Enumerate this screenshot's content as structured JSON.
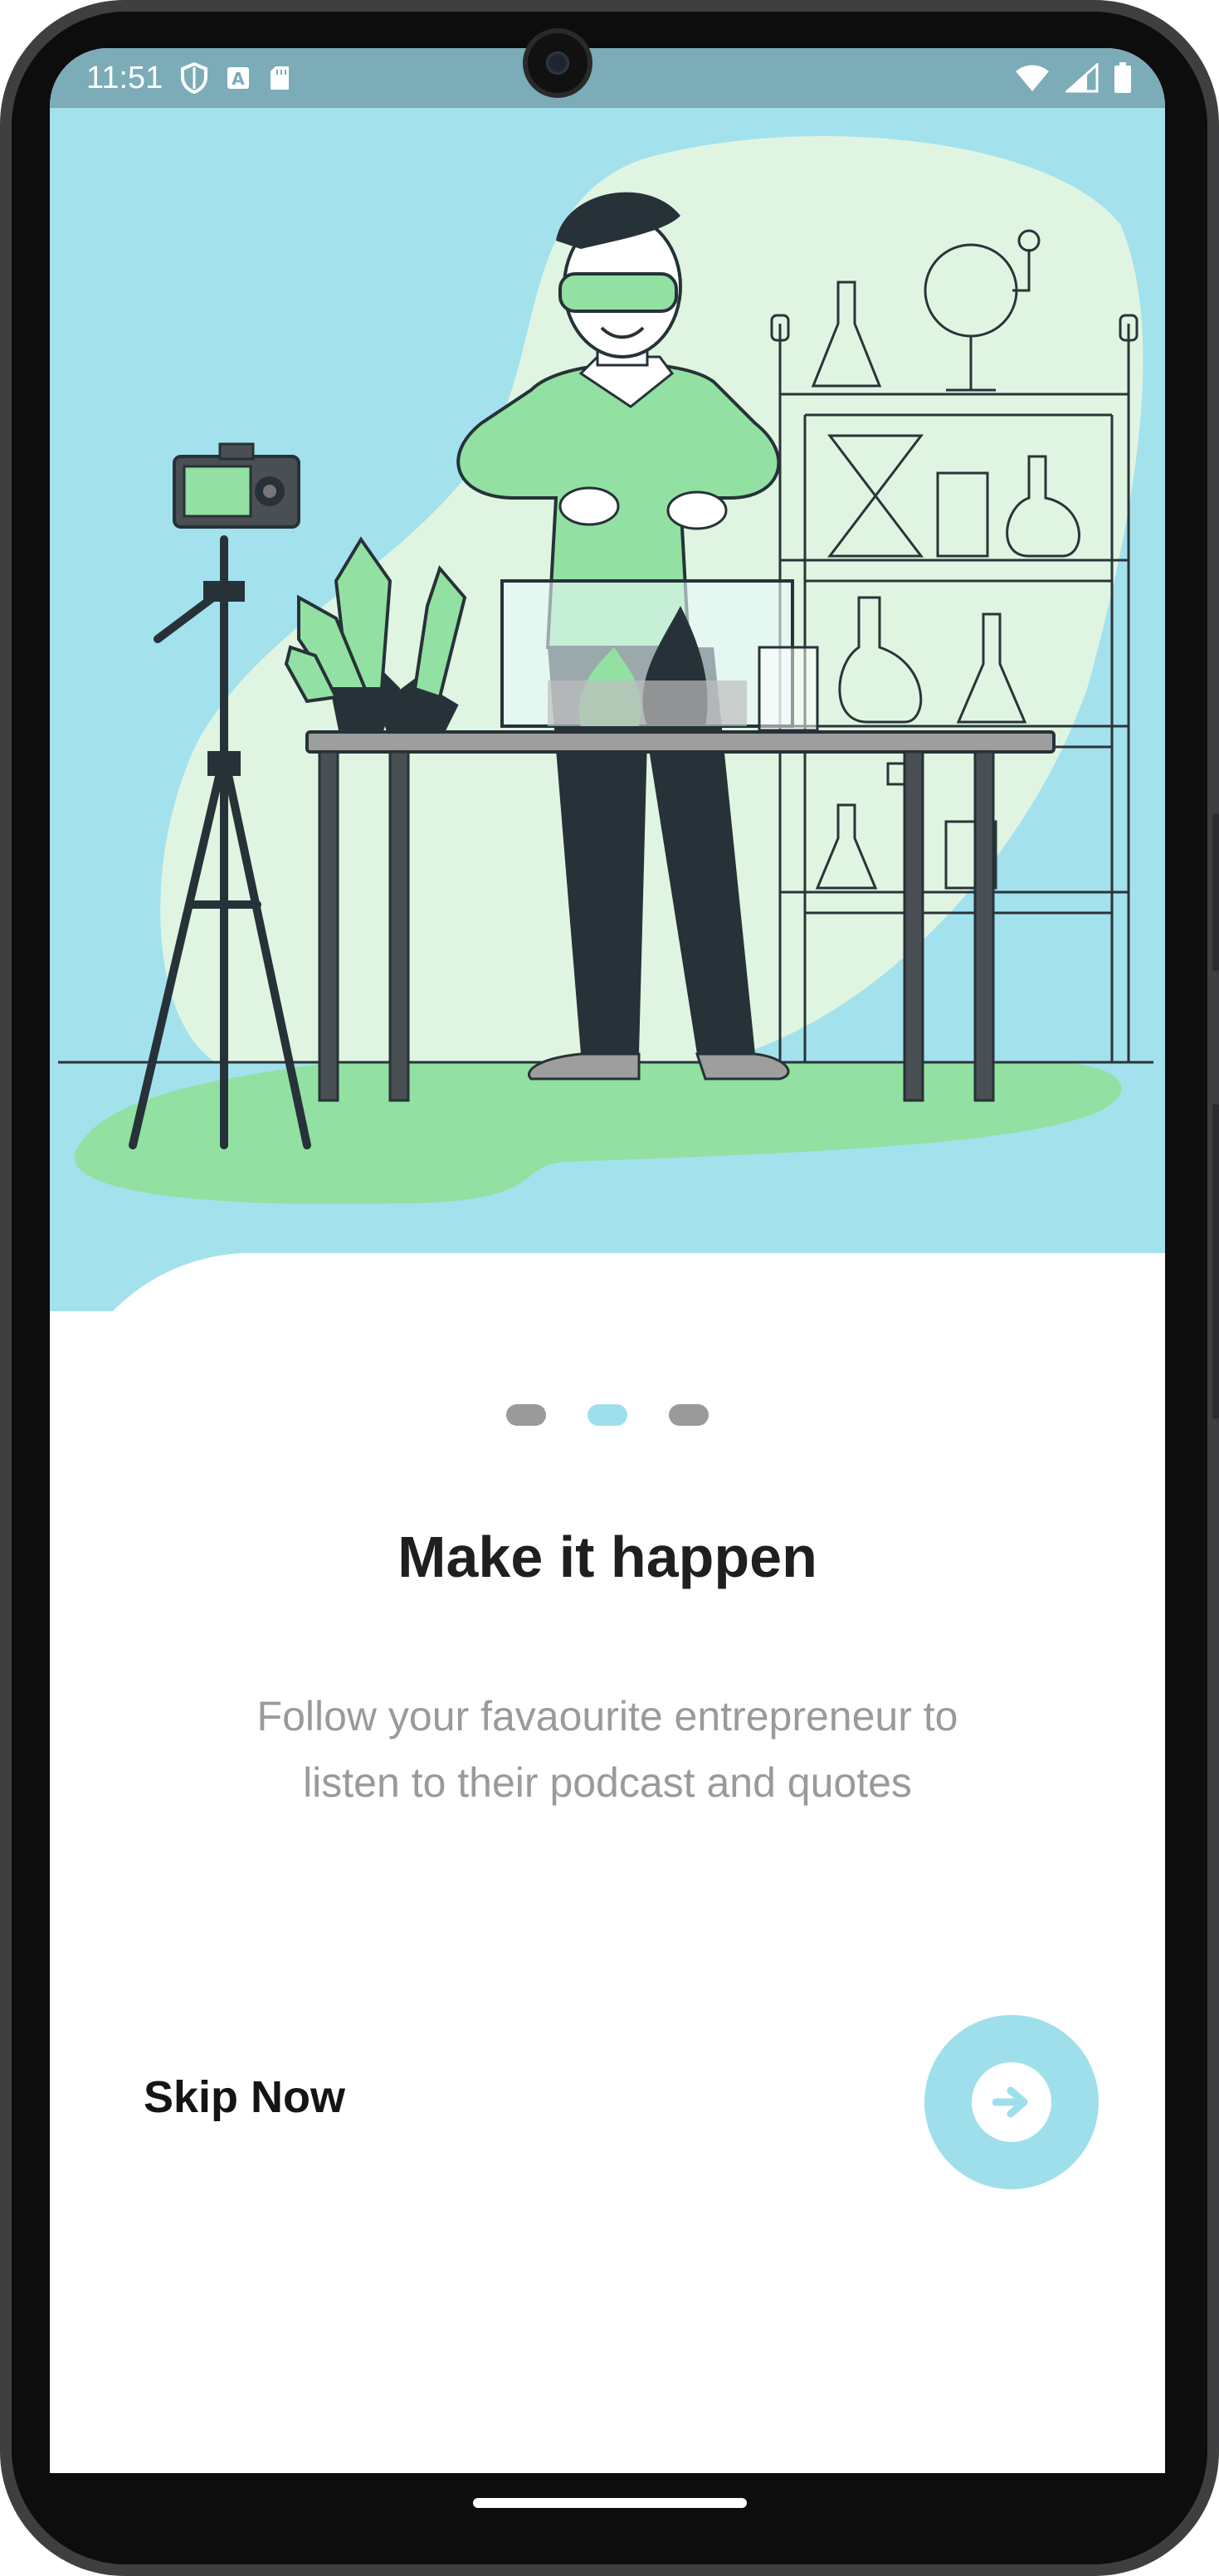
{
  "status_bar": {
    "time": "11:51",
    "icons_left": [
      "shield-icon",
      "a-notification-icon",
      "sd-card-icon"
    ],
    "icons_right": [
      "wifi-icon",
      "signal-icon",
      "battery-icon"
    ]
  },
  "colors": {
    "accent": "#9fdfec",
    "sky": "#a3e1ed",
    "status_bar": "#7bacb8",
    "green": "#92e0a2",
    "pale_green": "#dff5e2",
    "inactive_dot": "#9a9a9a"
  },
  "illustration": {
    "name": "scientist-lab-illustration"
  },
  "pagination": {
    "total": 3,
    "active_index": 1
  },
  "onboarding": {
    "title": "Make it happen",
    "subtitle_line1": "Follow your favaourite entrepreneur to",
    "subtitle_line2": "listen to their podcast and quotes",
    "skip_label": "Skip Now",
    "next_icon": "arrow-right-icon"
  }
}
